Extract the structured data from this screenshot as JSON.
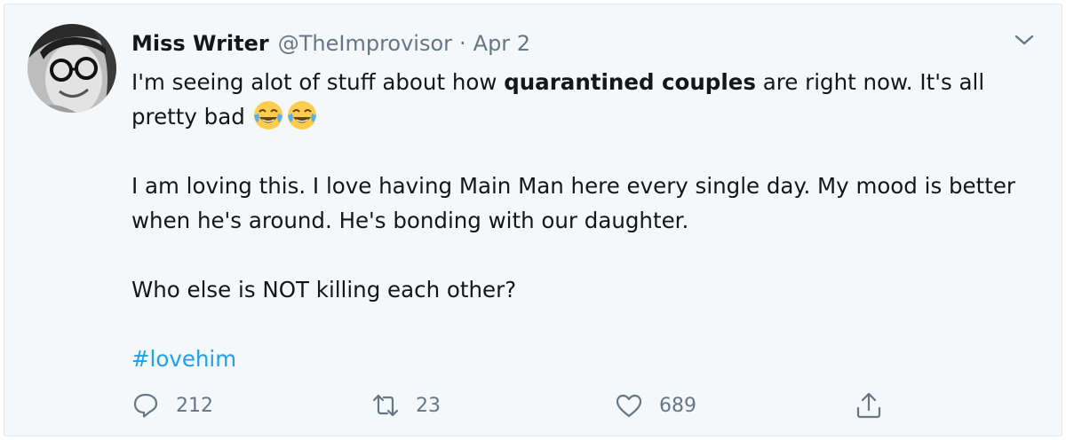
{
  "tweet": {
    "author_name": "Miss Writer",
    "handle": "@TheImprovisor",
    "separator": "·",
    "date": "Apr 2",
    "body": {
      "line1_pre": "I'm seeing alot of stuff about how ",
      "line1_bold": "quarantined couples",
      "line1_post": " are right now. It's all pretty bad ",
      "emojis": [
        "face-with-tears-of-joy-emoji",
        "face-with-tears-of-joy-emoji"
      ],
      "paragraph2": "I am loving this. I love having Main Man here every single day. My mood is better when he's around. He's bonding with our daughter.",
      "paragraph3": "Who else is NOT killing each other?",
      "hashtag": "#lovehim"
    },
    "actions": {
      "reply_icon": "reply-icon",
      "reply_count": "212",
      "retweet_icon": "retweet-icon",
      "retweet_count": "23",
      "like_icon": "heart-icon",
      "like_count": "689",
      "share_icon": "share-icon"
    },
    "colors": {
      "background": "#f5f8fa",
      "text": "#14171a",
      "muted": "#657786",
      "link": "#1da1f2",
      "emoji": "#ffcc4d"
    }
  }
}
